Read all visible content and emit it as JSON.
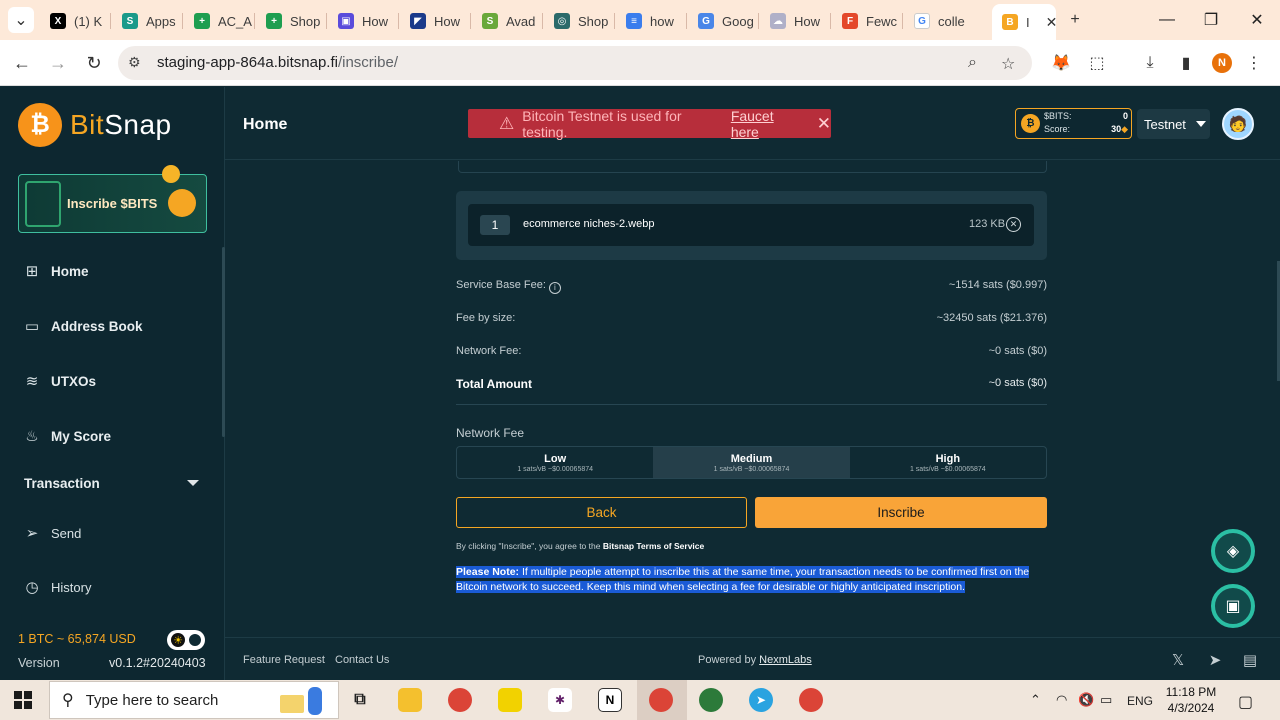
{
  "browser": {
    "tabs": [
      {
        "label": "(1) K",
        "icon": "x-twitter-icon",
        "color": "#000000",
        "glyph": "X"
      },
      {
        "label": "Apps",
        "icon": "apps-icon",
        "color": "#1a9a8a",
        "glyph": "S"
      },
      {
        "label": "AC_A",
        "icon": "sheets-icon",
        "color": "#1e9e50",
        "glyph": "+"
      },
      {
        "label": "Shop",
        "icon": "sheets-icon",
        "color": "#1e9e50",
        "glyph": "+"
      },
      {
        "label": "How",
        "icon": "video-icon",
        "color": "#5a4bdb",
        "glyph": "▣"
      },
      {
        "label": "How",
        "icon": "flag-icon",
        "color": "#1b3a8a",
        "glyph": "◤"
      },
      {
        "label": "Avad",
        "icon": "shopify-icon",
        "color": "#6aa83a",
        "glyph": "S"
      },
      {
        "label": "Shop",
        "icon": "app-icon",
        "color": "#2b6a6a",
        "glyph": "◎"
      },
      {
        "label": "how",
        "icon": "docs-icon",
        "color": "#3b7ded",
        "glyph": "≡"
      },
      {
        "label": "Goog",
        "icon": "translate-icon",
        "color": "#4a86e8",
        "glyph": "G"
      },
      {
        "label": "How",
        "icon": "cloud-icon",
        "color": "#b0b0c8",
        "glyph": "☁"
      },
      {
        "label": "Fewc",
        "icon": "figma-icon",
        "color": "#e4482a",
        "glyph": "F"
      },
      {
        "label": "colle",
        "icon": "google-icon",
        "color": "#ffffff",
        "glyph": "G"
      },
      {
        "label": "I",
        "icon": "bitsnap-icon",
        "color": "#f5a623",
        "glyph": "B"
      }
    ],
    "url_host": "staging-app-864a.bitsnap.fi",
    "url_path": "/inscribe/",
    "profile_initial": "N"
  },
  "sidebar": {
    "brand_left": "Bit",
    "brand_mid": "Sn",
    "brand_right": "ap",
    "banner_text": "Inscribe $BITS",
    "nav": [
      {
        "label": "Home",
        "icon": "grid-icon"
      },
      {
        "label": "Address Book",
        "icon": "book-icon"
      },
      {
        "label": "UTXOs",
        "icon": "layers-icon"
      },
      {
        "label": "My Score",
        "icon": "fire-icon"
      }
    ],
    "section_label": "Transaction",
    "sub_nav": [
      {
        "label": "Send",
        "icon": "send-icon"
      },
      {
        "label": "History",
        "icon": "clock-icon"
      }
    ],
    "btc_price": "1 BTC ~ 65,874 USD",
    "version_label": "Version",
    "version_value": "v0.1.2#20240403"
  },
  "header": {
    "title": "Home",
    "alert_text": "Bitcoin Testnet is used for testing.",
    "alert_link": "Faucet here",
    "bits_label": "$BITS:",
    "bits_value": "0",
    "score_label": "Score:",
    "score_value": "30",
    "network": "Testnet"
  },
  "main": {
    "file": {
      "index": "1",
      "name": "ecommerce niches-2.webp",
      "size": "123 KB"
    },
    "fees": [
      {
        "label": "Service Base Fee:",
        "value": "~1514 sats ($0.997)",
        "info": true
      },
      {
        "label": "Fee by size:",
        "value": "~32450 sats ($21.376)",
        "info": false
      },
      {
        "label": "Network Fee:",
        "value": "~0 sats ($0)",
        "info": false
      }
    ],
    "total_label": "Total Amount",
    "total_value": "~0 sats ($0)",
    "network_fee_label": "Network Fee",
    "fee_options": [
      {
        "label": "Low",
        "sub": "1 sats/vB ~$0.00065874"
      },
      {
        "label": "Medium",
        "sub": "1 sats/vB ~$0.00065874"
      },
      {
        "label": "High",
        "sub": "1 sats/vB ~$0.00065874"
      }
    ],
    "selected_fee": "Medium",
    "back_label": "Back",
    "inscribe_label": "Inscribe",
    "terms_prefix": "By clicking \"Inscribe\", you agree to the",
    "terms_link": "Bitsnap Terms of Service",
    "note_title": "Please Note:",
    "note_body": " If multiple people attempt to inscribe this at the same time, your transaction needs to be confirmed first on the Bitcoin network to succeed. Keep this mind when selecting a fee for desirable or highly anticipated inscription."
  },
  "footer": {
    "feature_request": "Feature Request",
    "contact_us": "Contact Us",
    "powered_by": "Powered by",
    "powered_link": "NexmLabs"
  },
  "taskbar": {
    "search_placeholder": "Type here to search",
    "lang": "ENG",
    "time": "11:18 PM",
    "date": "4/3/2024"
  },
  "colors": {
    "accent": "#f5a623",
    "background": "#0f2a33",
    "alert": "#b72e3b",
    "teal": "#2bbfa4"
  }
}
